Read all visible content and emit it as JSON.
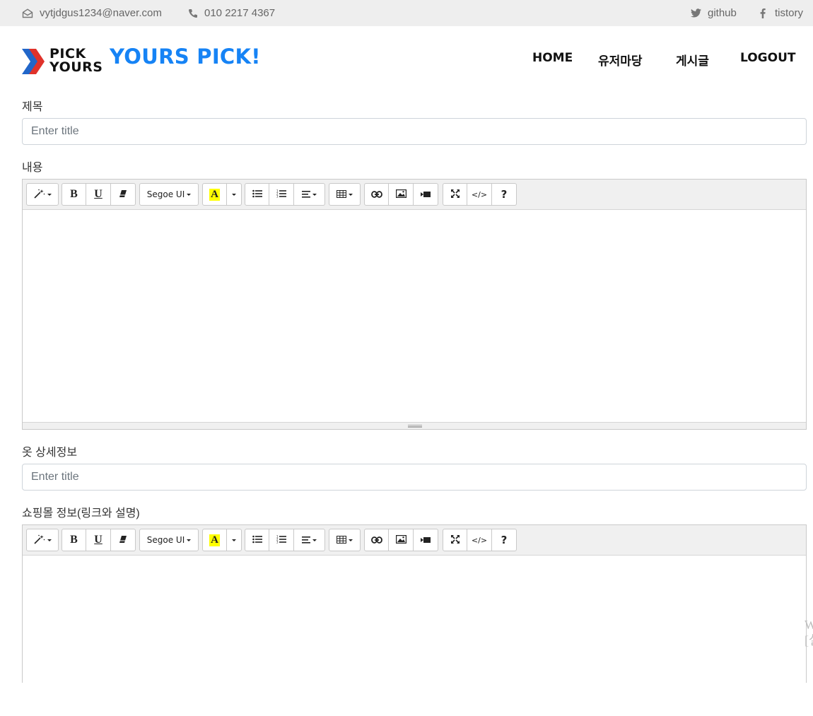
{
  "topbar": {
    "email": "vytjdgus1234@naver.com",
    "phone": "010 2217 4367",
    "github": "github",
    "tistory": "tistory",
    "email_icon": "envelope-icon",
    "phone_icon": "phone-icon",
    "github_icon": "twitter-bird-icon",
    "tistory_icon": "facebook-f-icon"
  },
  "header": {
    "logo_line1": "PICK",
    "logo_line2": "YOURS",
    "brand": "YOURS PICK!",
    "brand_color": "#1683f5",
    "logo_colors": [
      "#2166c9",
      "#e0322b"
    ],
    "nav": [
      "HOME",
      "유저마당",
      "게시글",
      "LOGOUT"
    ]
  },
  "form": {
    "title_label": "제목",
    "title_placeholder": "Enter title",
    "content_label": "내용",
    "clothes_label": "옷 상세정보",
    "clothes_placeholder": "Enter title",
    "shop_label": "쇼핑몰 정보(링크와 설명)"
  },
  "editor_toolbar": {
    "font_name": "Segoe UI",
    "bold": "B",
    "underline": "U",
    "help": "?",
    "code": "</>",
    "highlight_letter": "A",
    "highlight_color": "#ffff00"
  },
  "watermark": {
    "line1": "W",
    "line2": "[설"
  }
}
